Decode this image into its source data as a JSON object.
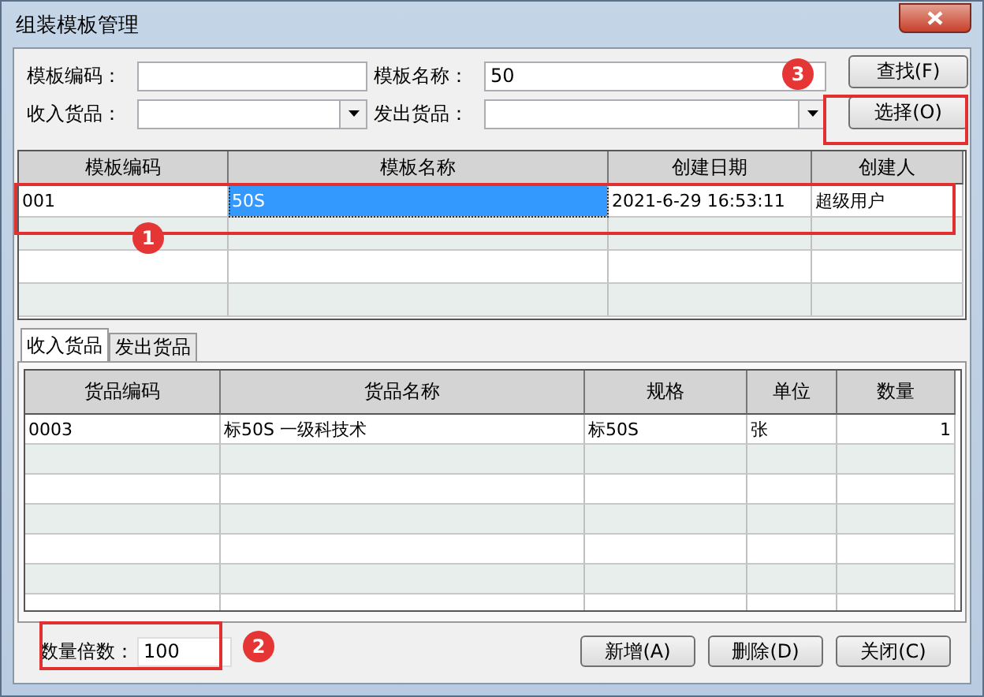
{
  "window": {
    "title": "组装模板管理"
  },
  "filters": {
    "code_label": "模板编码：",
    "name_label": "模板名称：",
    "name_value": "50",
    "in_label": "收入货品：",
    "out_label": "发出货品："
  },
  "top_buttons": [
    "查找(F)",
    "选择(O)"
  ],
  "templates": {
    "columns": [
      "模板编码",
      "模板名称",
      "创建日期",
      "创建人"
    ],
    "rows": [
      {
        "cells": [
          {
            "text": "001",
            "selected": false
          },
          {
            "text": "50S",
            "selected": true
          },
          {
            "text": "2021-6-29 16:53:11",
            "selected": false
          },
          {
            "text": "超级用户",
            "selected": false
          }
        ]
      }
    ]
  },
  "tabs": [
    {
      "label": "收入货品",
      "selected": true
    },
    {
      "label": "发出货品",
      "selected": false
    }
  ],
  "goods": {
    "columns": [
      "货品编码",
      "货品名称",
      "规格",
      "单位",
      "数量"
    ],
    "rows": [
      [
        "0003",
        "标50S 一级科技术",
        "标50S",
        "张",
        "1"
      ]
    ]
  },
  "multiplier": {
    "label": "数量倍数：",
    "value": "100"
  },
  "bottom_buttons": [
    "新增(A)",
    "删除(D)",
    "关闭(C)"
  ],
  "callouts": [
    {
      "label": "1"
    },
    {
      "label": "2"
    },
    {
      "label": "3"
    }
  ]
}
